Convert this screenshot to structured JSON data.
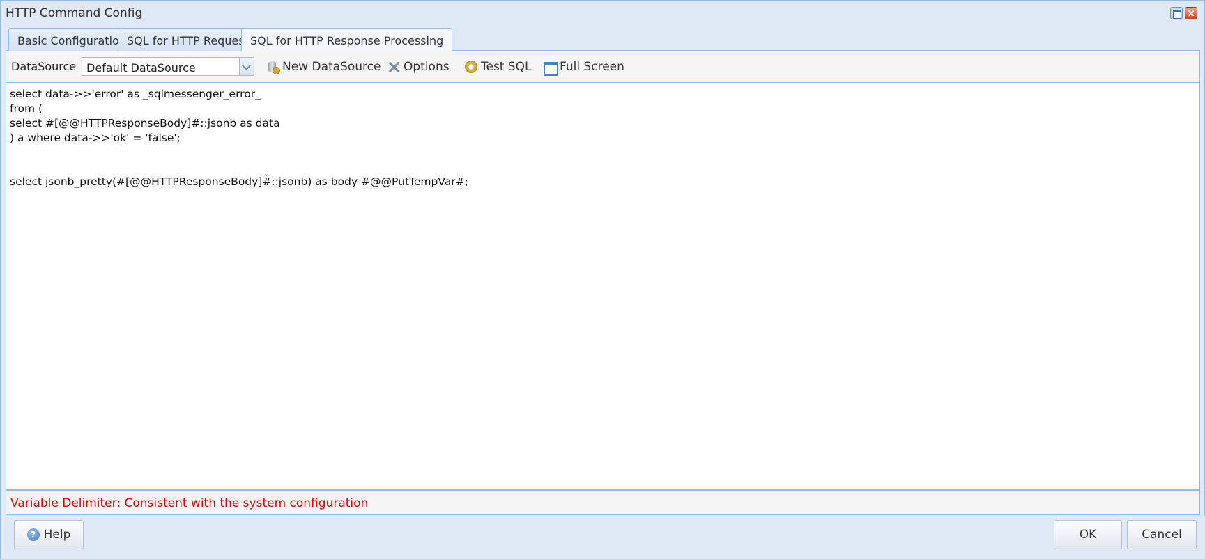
{
  "window": {
    "title": "HTTP Command Config"
  },
  "tabs": [
    {
      "label": "Basic Configuration",
      "active": false
    },
    {
      "label": "SQL for HTTP Request",
      "active": false
    },
    {
      "label": "SQL for HTTP Response Processing",
      "active": true
    }
  ],
  "toolbar": {
    "datasource_label": "DataSource",
    "datasource_value": "Default DataSource",
    "new_datasource_label": "New DataSource",
    "options_label": "Options",
    "test_sql_label": "Test SQL",
    "full_screen_label": "Full Screen"
  },
  "editor": {
    "lines": [
      "select data->>'error' as _sqlmessenger_error_",
      "from (",
      "select #[@@HTTPResponseBody]#::jsonb as data",
      ") a where data->>'ok' = 'false';",
      "",
      "",
      "select jsonb_pretty(#[@@HTTPResponseBody]#::jsonb) as body #@@PutTempVar#;"
    ]
  },
  "status": {
    "text": "Variable Delimiter: Consistent with the system configuration",
    "color": "#e00000"
  },
  "footer": {
    "help_label": "Help",
    "ok_label": "OK",
    "cancel_label": "Cancel"
  },
  "colors": {
    "frame": "#dfe9f6",
    "border": "#99bbe8"
  }
}
